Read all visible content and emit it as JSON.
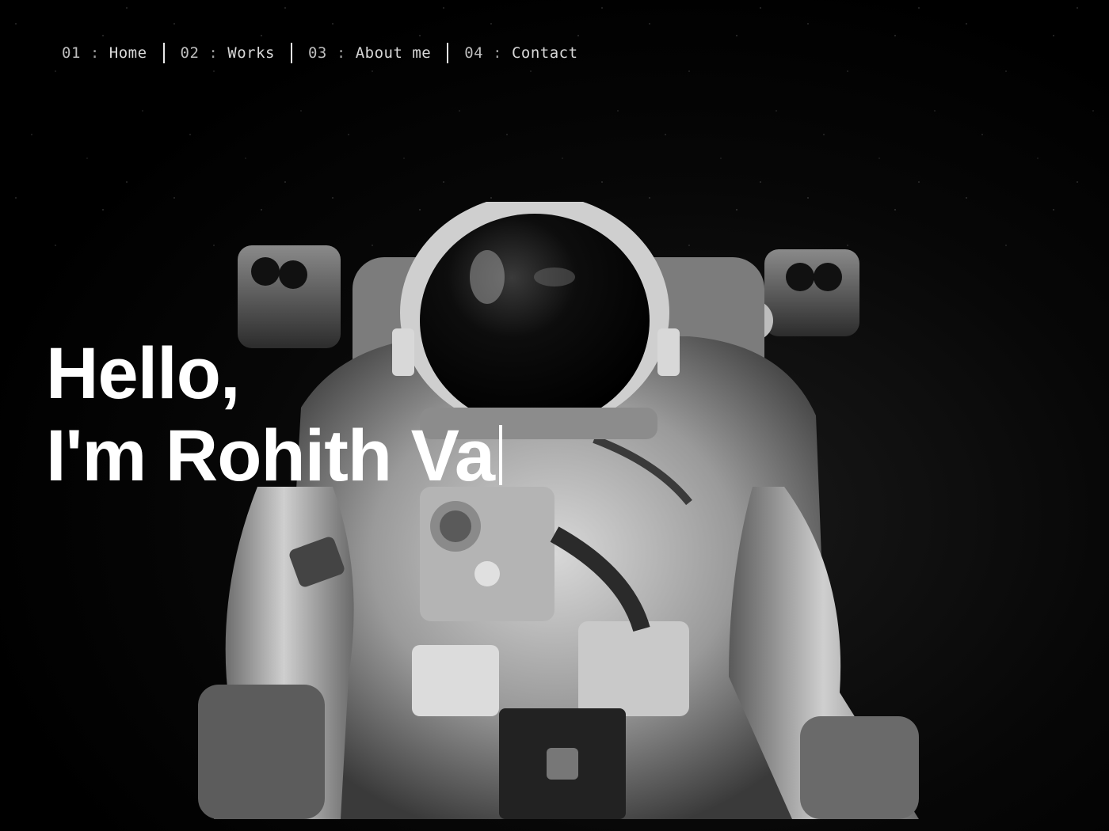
{
  "nav": {
    "items": [
      {
        "number": "01",
        "separator": ":",
        "label": "Home"
      },
      {
        "number": "02",
        "separator": ":",
        "label": "Works"
      },
      {
        "number": "03",
        "separator": ":",
        "label": "About me"
      },
      {
        "number": "04",
        "separator": ":",
        "label": "Contact"
      }
    ]
  },
  "hero": {
    "greeting": "Hello,",
    "name_line": "I'm Rohith Va"
  },
  "colors": {
    "background": "#000000",
    "text": "#ffffff",
    "nav_text": "#d8d8d8"
  },
  "icons": {
    "hero_image": "astronaut-photo",
    "typing_cursor": "text-cursor"
  }
}
